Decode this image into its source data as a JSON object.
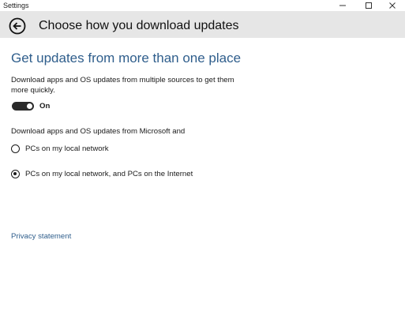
{
  "window": {
    "title": "Settings",
    "controls": {
      "minimize_icon": "minimize-icon",
      "maximize_icon": "maximize-icon",
      "close_icon": "close-icon"
    }
  },
  "header": {
    "back_icon": "back-arrow-icon",
    "title": "Choose how you download updates"
  },
  "content": {
    "heading": "Get updates from more than one place",
    "description": "Download apps and OS updates from multiple sources to get them more quickly.",
    "toggle": {
      "state": "on",
      "label": "On"
    },
    "source_label": "Download apps and OS updates from Microsoft and",
    "options": [
      {
        "label": "PCs on my local network",
        "selected": false
      },
      {
        "label": "PCs on my local network, and PCs on the Internet",
        "selected": true
      }
    ],
    "privacy_link": "Privacy statement"
  },
  "colors": {
    "accent": "#2f5e8c",
    "header_bg": "#e6e6e6",
    "text": "#1a1a1a"
  }
}
